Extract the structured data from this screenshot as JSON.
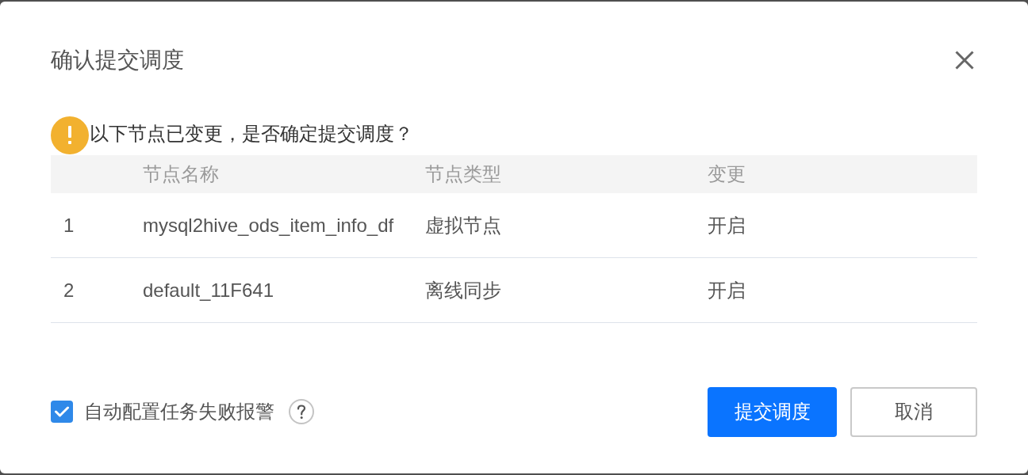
{
  "dialog": {
    "title": "确认提交调度"
  },
  "warning": {
    "message": "以下节点已变更，是否确定提交调度？"
  },
  "table": {
    "columns": [
      "节点名称",
      "节点类型",
      "变更"
    ],
    "rows": [
      {
        "index": "1",
        "name": "mysql2hive_ods_item_info_df",
        "type": "虚拟节点",
        "change": "开启"
      },
      {
        "index": "2",
        "name": "default_11F641",
        "type": "离线同步",
        "change": "开启"
      }
    ]
  },
  "alarm_option": {
    "label": "自动配置任务失败报警",
    "checked": true
  },
  "buttons": [
    {
      "label": "提交调度",
      "kind": "primary"
    },
    {
      "label": "取消",
      "kind": "default"
    }
  ]
}
